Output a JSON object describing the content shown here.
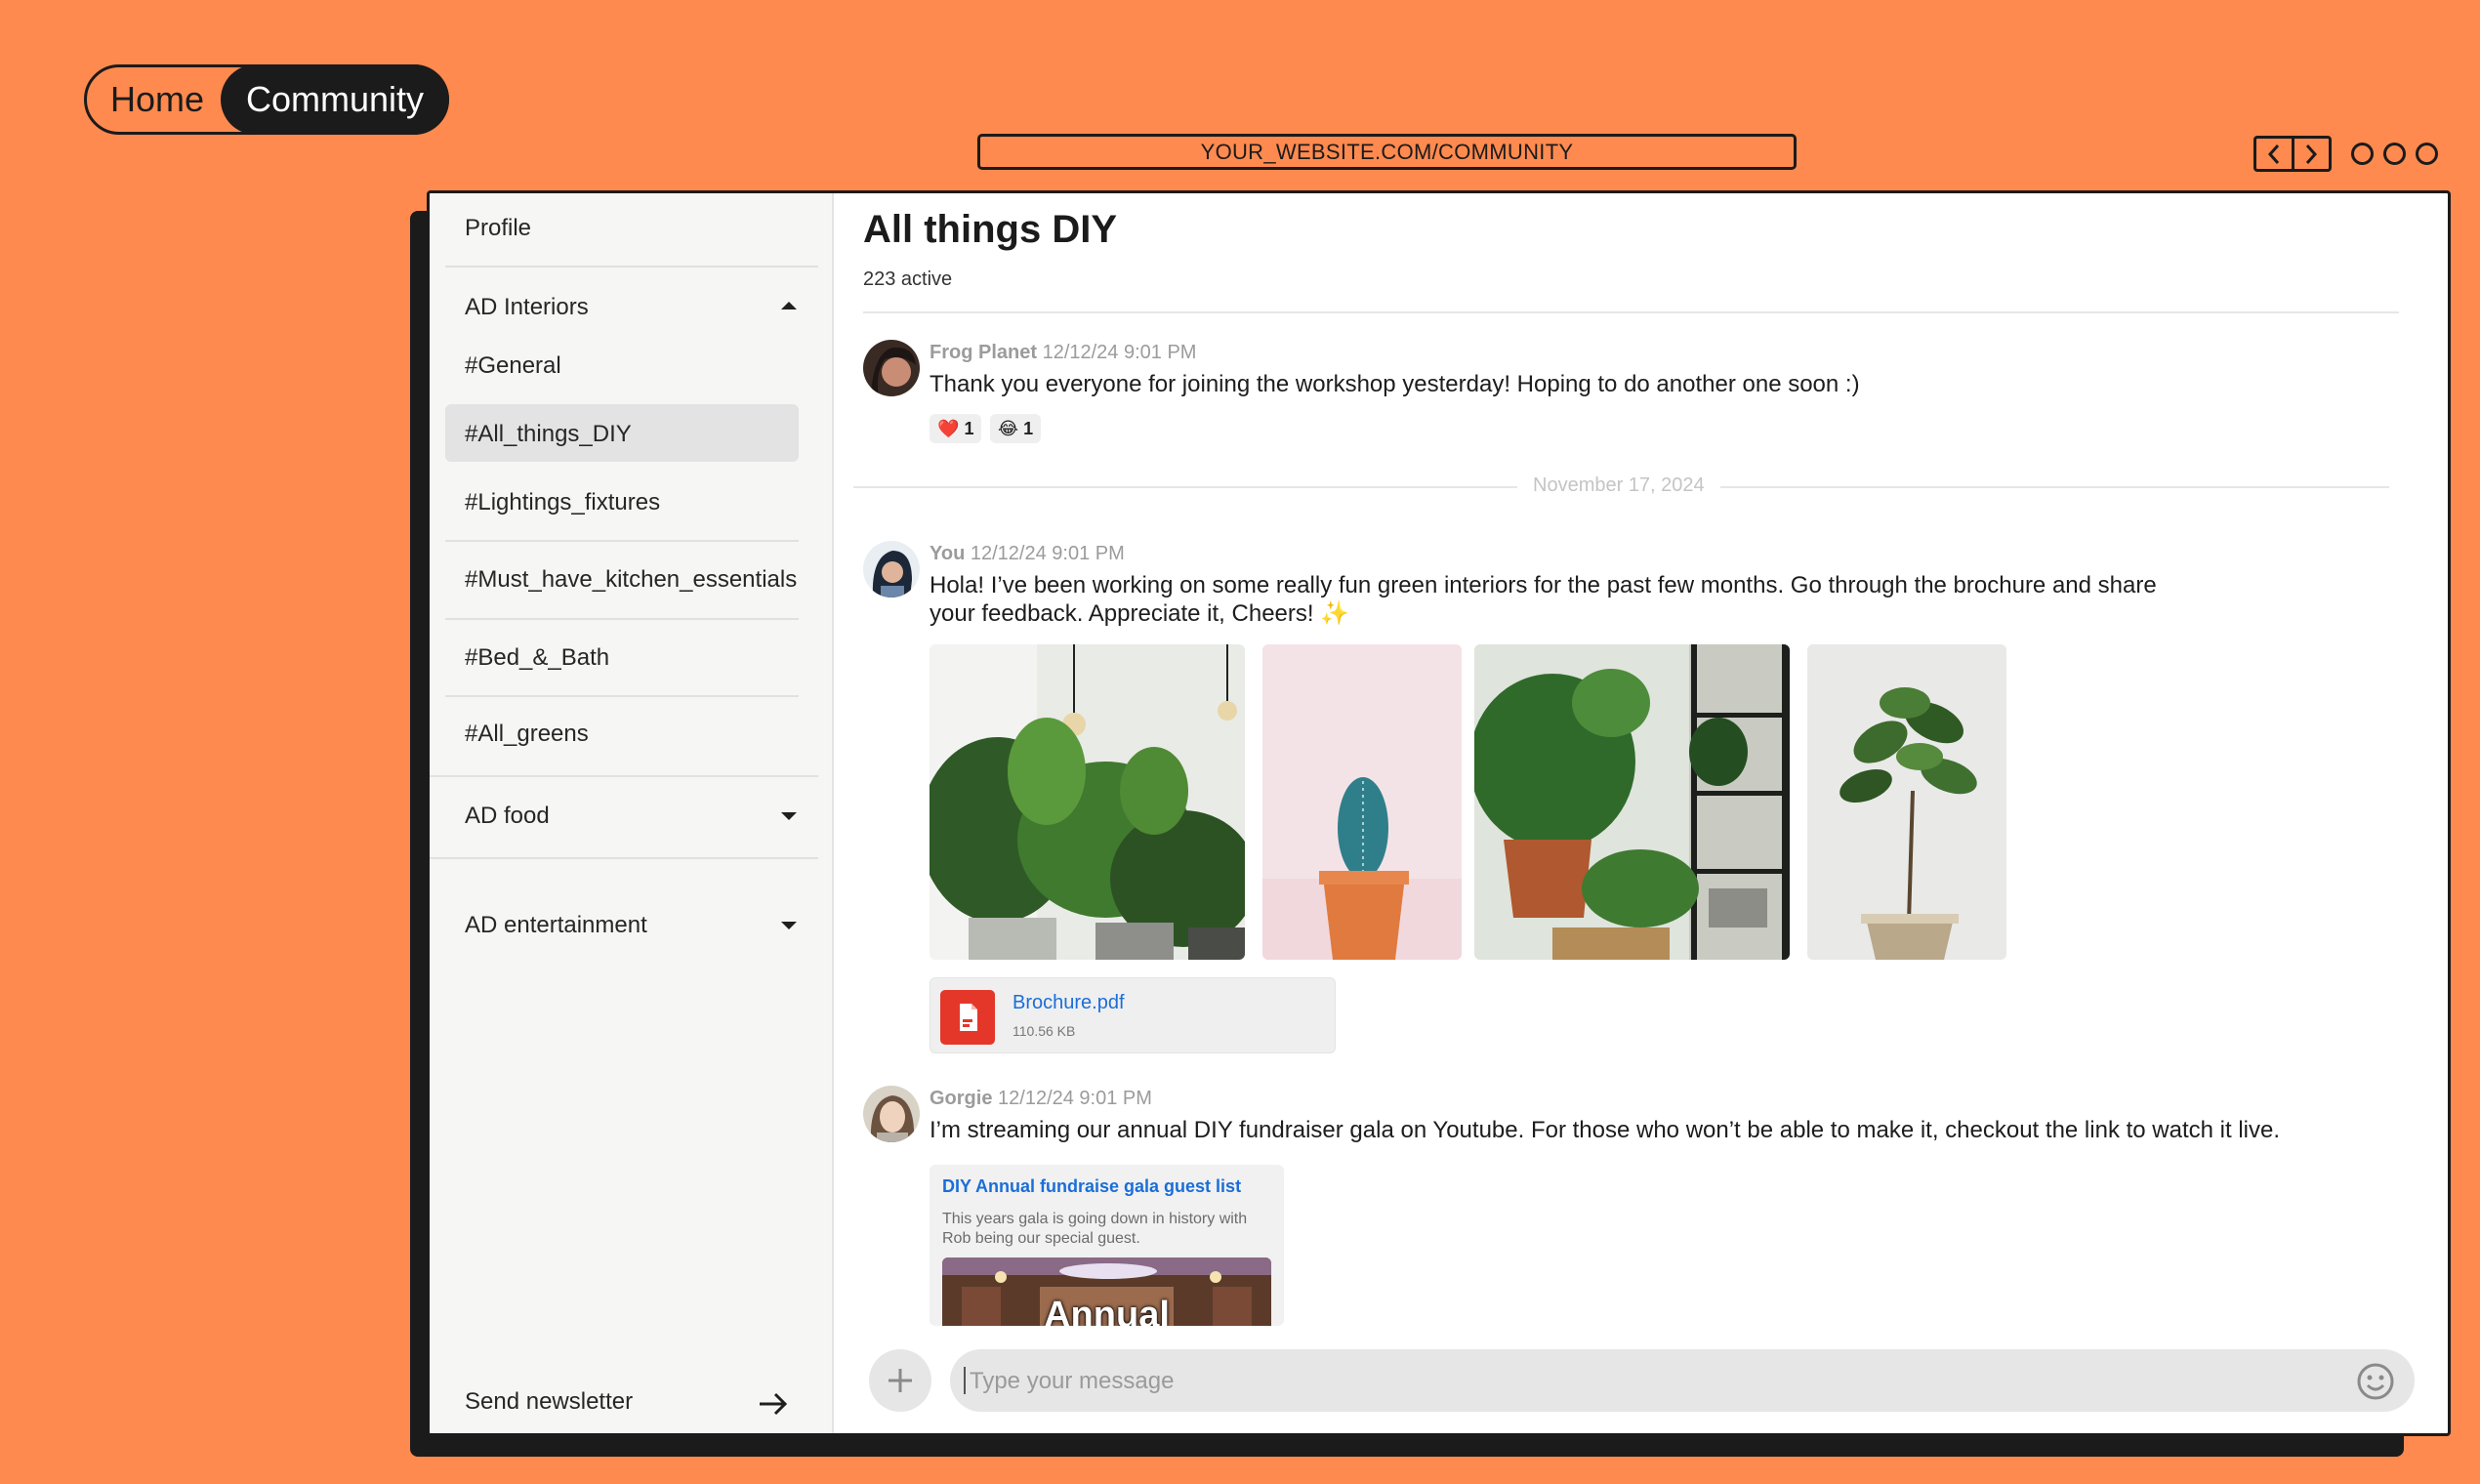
{
  "topnav": {
    "home_label": "Home",
    "community_label": "Community"
  },
  "browser": {
    "url": "YOUR_WEBSITE.COM/COMMUNITY"
  },
  "sidebar": {
    "profile_label": "Profile",
    "groups": [
      {
        "label": "AD Interiors",
        "expanded": true
      },
      {
        "label": "AD food",
        "expanded": false
      },
      {
        "label": "AD entertainment",
        "expanded": false
      }
    ],
    "channels": [
      "#General",
      "#All_things_DIY",
      "#Lightings_fixtures",
      "#Must_have_kitchen_essentials",
      "#Bed_&_Bath",
      "#All_greens"
    ],
    "selected_channel": "#All_things_DIY",
    "newsletter_label": "Send newsletter"
  },
  "channel": {
    "title": "All things DIY",
    "active_count": "223 active"
  },
  "messages": [
    {
      "author": "Frog Planet",
      "timestamp": "12/12/24 9:01 PM",
      "text": "Thank you everyone for joining the workshop yesterday! Hoping to do another one soon :)",
      "reactions": [
        {
          "emoji": "❤️",
          "count": "1"
        },
        {
          "emoji": "😂",
          "count": "1"
        }
      ]
    },
    {
      "author": "You",
      "timestamp": "12/12/24 9:01 PM",
      "text": "Hola! I’ve been working on some really fun green interiors for the past few months. Go through the brochure and share your feedback. Appreciate it, Cheers! ✨",
      "attachment": {
        "name": "Brochure.pdf",
        "size": "110.56 KB"
      }
    },
    {
      "author": "Gorgie",
      "timestamp": "12/12/24 9:01 PM",
      "text": "I’m streaming our annual DIY fundraiser gala on Youtube. For those who won’t be able to make it, checkout the link to watch it live.",
      "link_preview": {
        "title": "DIY Annual fundraise gala guest list",
        "description": "This years gala is going down in history with Rob being our special guest.",
        "image_text": "Annual"
      }
    }
  ],
  "date_separator": "November 17, 2024",
  "composer": {
    "placeholder": "Type your message"
  },
  "colors": {
    "background": "#FF8A4F",
    "dark": "#1B1B1B",
    "link": "#1A6ED8",
    "pdf": "#E4372A"
  }
}
